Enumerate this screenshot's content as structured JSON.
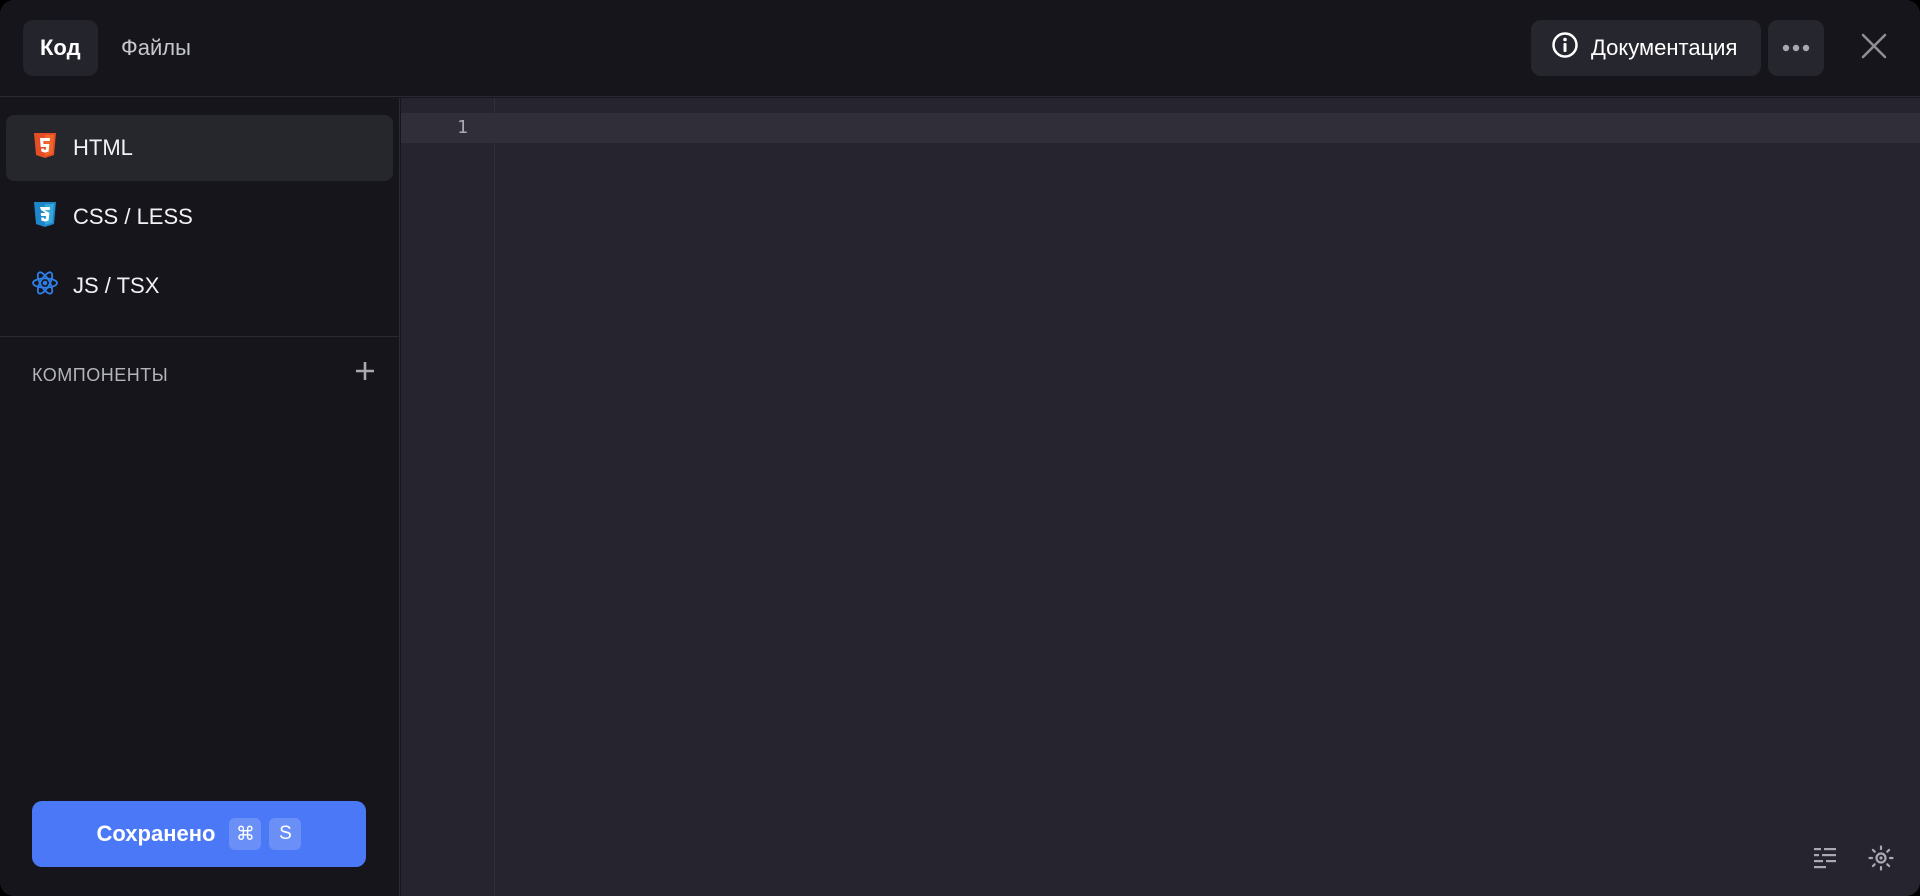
{
  "header": {
    "tabs": [
      {
        "label": "Код",
        "active": true
      },
      {
        "label": "Файлы",
        "active": false
      }
    ],
    "docs_label": "Документация"
  },
  "sidebar": {
    "items": [
      {
        "label": "HTML",
        "icon": "html5-icon",
        "active": true
      },
      {
        "label": "CSS / LESS",
        "icon": "css3-icon",
        "active": false
      },
      {
        "label": "JS / TSX",
        "icon": "react-icon",
        "active": false
      }
    ],
    "components_title": "КОМПОНЕНТЫ",
    "save": {
      "label": "Сохранено",
      "shortcut_mod": "⌘",
      "shortcut_key": "S"
    }
  },
  "editor": {
    "line_numbers": [
      "1"
    ],
    "content": ""
  },
  "colors": {
    "background": "#15151b",
    "editor_background": "#26252f",
    "accent": "#4a78f7",
    "html_icon": "#e44d26",
    "css_icon": "#2b9fe0",
    "react_icon": "#2f7fe8"
  }
}
